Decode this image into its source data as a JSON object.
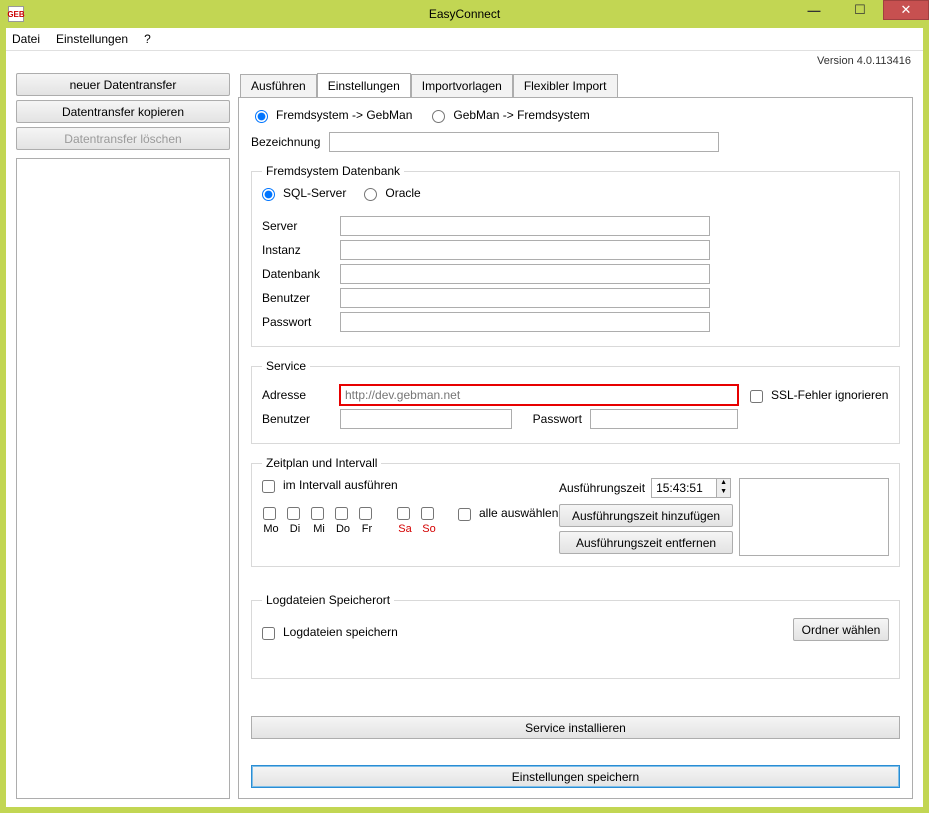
{
  "window": {
    "title": "EasyConnect",
    "icon_text": "GEB"
  },
  "menu": {
    "file": "Datei",
    "settings": "Einstellungen",
    "help": "?"
  },
  "version": "Version 4.0.113416",
  "left": {
    "btn_new": "neuer Datentransfer",
    "btn_copy": "Datentransfer kopieren",
    "btn_delete": "Datentransfer löschen"
  },
  "tabs": {
    "execute": "Ausführen",
    "settings": "Einstellungen",
    "templates": "Importvorlagen",
    "flex": "Flexibler Import"
  },
  "direction": {
    "to_gebman": "Fremdsystem -> GebMan",
    "from_gebman": "GebMan -> Fremdsystem"
  },
  "labels": {
    "bezeichnung": "Bezeichnung",
    "server": "Server",
    "instanz": "Instanz",
    "datenbank": "Datenbank",
    "benutzer": "Benutzer",
    "passwort": "Passwort",
    "adresse": "Adresse",
    "ausfuehrungszeit": "Ausführungszeit"
  },
  "fieldsets": {
    "db_legend": "Fremdsystem Datenbank",
    "db_sql": "SQL-Server",
    "db_oracle": "Oracle",
    "service_legend": "Service",
    "ssl_ignore": "SSL-Fehler ignorieren",
    "schedule_legend": "Zeitplan und Intervall",
    "interval_run": "im Intervall ausführen",
    "select_all": "alle auswählen",
    "log_legend": "Logdateien Speicherort",
    "log_save": "Logdateien speichern"
  },
  "service": {
    "adresse_placeholder": "http://dev.gebman.net",
    "adresse_value": ""
  },
  "days": {
    "mo": "Mo",
    "di": "Di",
    "mi": "Mi",
    "do": "Do",
    "fr": "Fr",
    "sa": "Sa",
    "so": "So"
  },
  "schedule": {
    "time_value": "15:43:51",
    "btn_add_time": "Ausführungszeit hinzufügen",
    "btn_remove_time": "Ausführungszeit entfernen"
  },
  "buttons": {
    "choose_folder": "Ordner wählen",
    "install_service": "Service installieren",
    "save_settings": "Einstellungen speichern"
  }
}
